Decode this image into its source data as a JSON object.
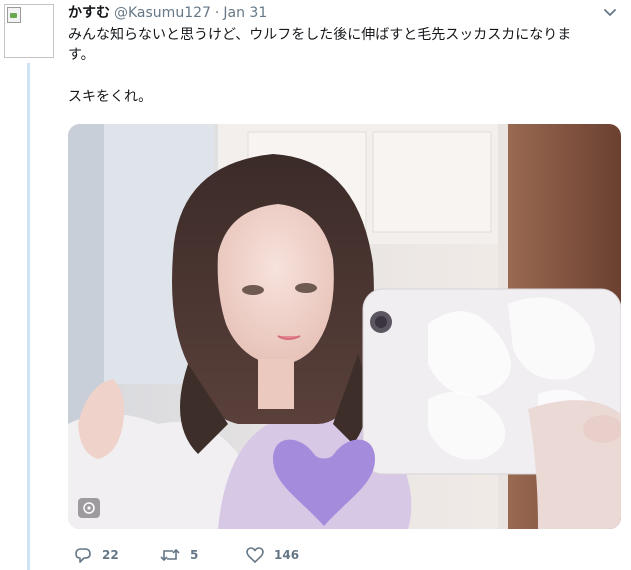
{
  "tweet": {
    "display_name": "かすむ",
    "handle": "@Kasumu127",
    "separator": "·",
    "timestamp": "Jan 31",
    "text_lines": [
      "みんな知らないと思うけど、ウルフをした後に伸ばすと毛先スッカスカになりま",
      "す。",
      "スキをくれ。"
    ]
  },
  "actions": {
    "reply_count": "22",
    "retweet_count": "5",
    "like_count": "146"
  },
  "media": {
    "description_icon": "photo-media",
    "overlay_shape": "heart",
    "overlay_color": "#a58bdc"
  },
  "colors": {
    "thread_line": "#cfe3f5",
    "muted_text": "#657786",
    "primary_text": "#14171a"
  }
}
